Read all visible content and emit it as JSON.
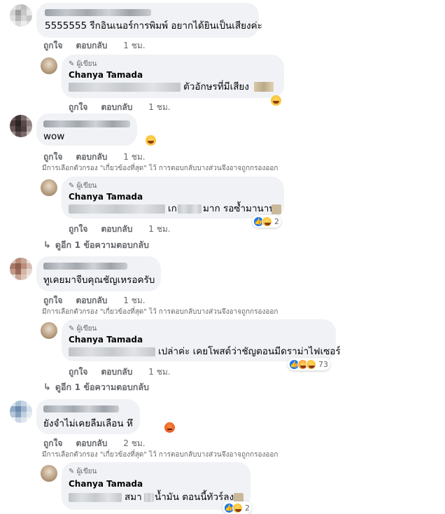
{
  "comments": [
    {
      "id": "c1",
      "text": "5555555 รีกอินเนอร์การพิมพ์ อยากได้ยินเป็นเสียงค่ะ",
      "actions": {
        "like": "ถูกใจ",
        "reply": "ตอบกลับ",
        "time": "1 ชม."
      }
    },
    {
      "id": "c2",
      "text": "wow",
      "actions": {
        "like": "ถูกใจ",
        "reply": "ตอบกลับ",
        "time": "1 ชม."
      },
      "filter_note": "มีการเลือกตัวกรอง \"เกี่ยวข้องที่สุด\" ไว้ การตอบกลับบางส่วนจึงอาจถูกกรองออก",
      "more_replies": "ดูอีก 1 ข้อความตอบกลับ"
    },
    {
      "id": "c3",
      "text": "ทูเคยมาจีบคุณชัญเหรอครับ",
      "actions": {
        "like": "ถูกใจ",
        "reply": "ตอบกลับ",
        "time": "1 ชม."
      },
      "filter_note": "มีการเลือกตัวกรอง \"เกี่ยวข้องที่สุด\" ไว้ การตอบกลับบางส่วนจึงอาจถูกกรองออก",
      "more_replies": "ดูอีก 1 ข้อความตอบกลับ"
    },
    {
      "id": "c4",
      "text": "ยังจำไม่เคยลืมเลือน หึ",
      "actions": {
        "like": "ถูกใจ",
        "reply": "ตอบกลับ",
        "time": "2 ชม."
      },
      "filter_note": "มีการเลือกตัวกรอง \"เกี่ยวข้องที่สุด\" ไว้ การตอบกลับบางส่วนจึงอาจถูกกรองออก"
    }
  ],
  "replies": [
    {
      "author_badge": "ผู้เขียน",
      "author": "Chanya Tamada",
      "text": "ตัวอักษรที่มีเสียง",
      "actions": {
        "like": "ถูกใจ",
        "reply": "ตอบกลับ",
        "time": "1 ชม."
      }
    },
    {
      "author_badge": "ผู้เขียน",
      "author": "Chanya Tamada",
      "text_a": "เก",
      "text_b": "มาก รอซ้ำมานาน",
      "reaction_count": "2",
      "actions": {
        "like": "ถูกใจ",
        "reply": "ตอบกลับ",
        "time": "1 ชม."
      }
    },
    {
      "author_badge": "ผู้เขียน",
      "author": "Chanya Tamada",
      "text": "เปล่าค่ะ เคยโพสต์ว่าชัญตอนมีดราม่าไฟเซอร์",
      "reaction_count": "73",
      "actions": {
        "like": "ถูกใจ",
        "reply": "ตอบกลับ",
        "time": "1 ชม."
      }
    },
    {
      "author_badge": "ผู้เขียน",
      "author": "Chanya Tamada",
      "text_a": "สมา",
      "text_b": "น้ำมัน ตอนนี้ทัวร์ลง",
      "reaction_count": "2"
    }
  ],
  "colors": {
    "bubble": "#f0f2f5",
    "secondary_text": "#65676b",
    "like_blue": "#1877f2"
  }
}
